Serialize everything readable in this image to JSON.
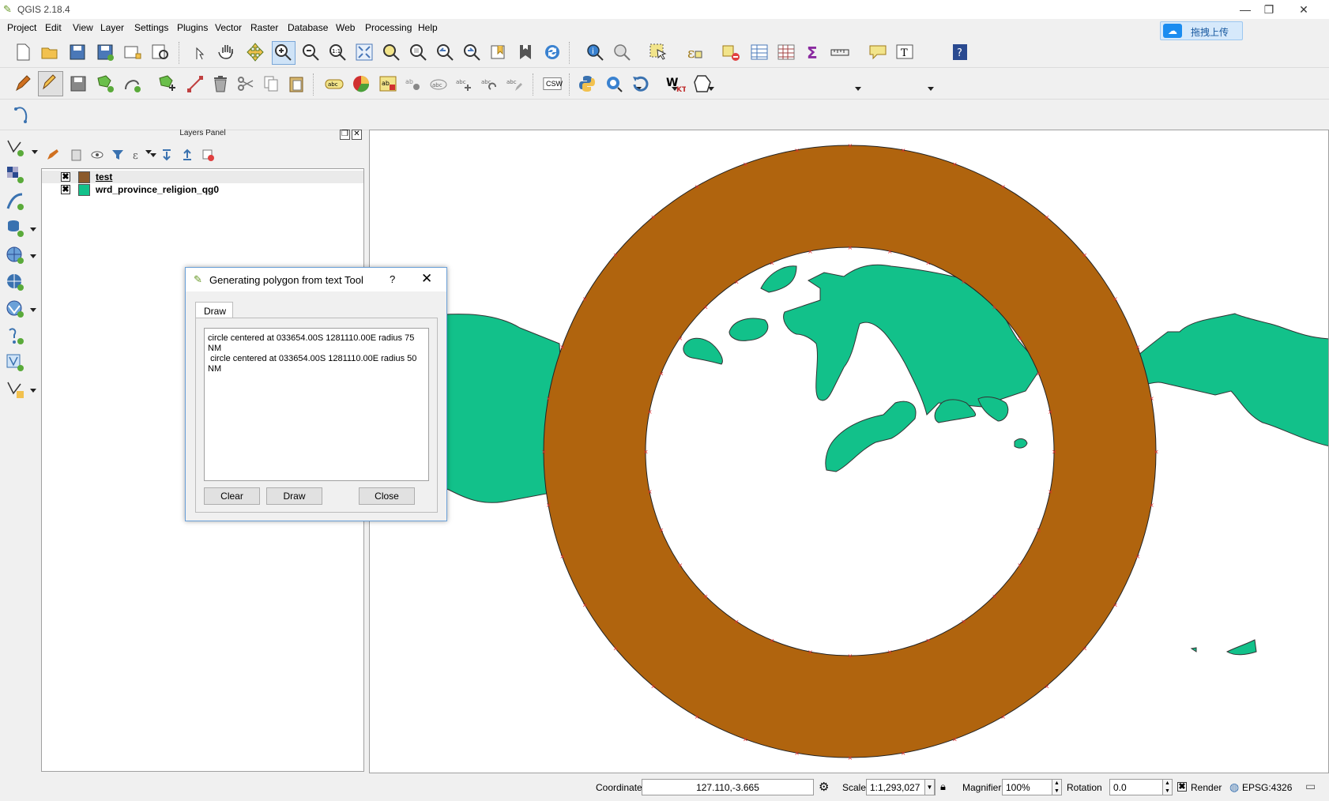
{
  "window": {
    "title": "QGIS 2.18.4",
    "controls": [
      "—",
      "❐",
      "✕"
    ]
  },
  "menu": [
    "Project",
    "Edit",
    "View",
    "Layer",
    "Settings",
    "Plugins",
    "Vector",
    "Raster",
    "Database",
    "Web",
    "Processing",
    "Help"
  ],
  "baidu_button": {
    "label": "拖拽上传"
  },
  "toolbar_extra": {
    "csw_label": "CSW"
  },
  "layers_panel": {
    "title": "Layers Panel",
    "layers": [
      {
        "name": "test",
        "checked": "✖",
        "color": "#8b5a2b"
      },
      {
        "name": "wrd_province_religion_qg0",
        "checked": "✖",
        "color": "#12c18a"
      }
    ]
  },
  "dialog": {
    "title": "Generating polygon from text Tool",
    "help": "?",
    "close_x": "✕",
    "tab": "Draw",
    "text": "circle centered at 033654.00S 1281110.00E radius 75 NM\n circle centered at 033654.00S 1281110.00E radius 50 NM",
    "buttons": {
      "clear": "Clear",
      "draw": "Draw",
      "close": "Close"
    }
  },
  "map": {
    "ring_color": "#b0640e",
    "land_color": "#12c18a",
    "vertex_marker_color": "#e03030"
  },
  "status": {
    "coordinate_label": "Coordinate",
    "coordinate_value": "127.110,-3.665",
    "scale_label": "Scale",
    "scale_value": "1:1,293,027",
    "magnifier_label": "Magnifier",
    "magnifier_value": "100%",
    "rotation_label": "Rotation",
    "rotation_value": "0.0",
    "render_label": "Render",
    "render_checked": "✖",
    "crs": "EPSG:4326"
  }
}
